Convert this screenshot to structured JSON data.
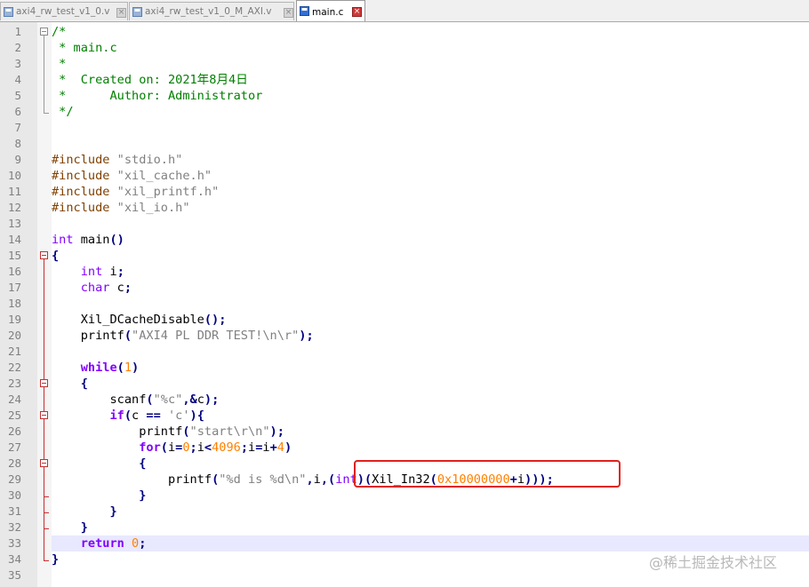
{
  "tabs": [
    {
      "label": "axi4_rw_test_v1_0.v",
      "active": false
    },
    {
      "label": "axi4_rw_test_v1_0_M_AXI.v",
      "active": false
    },
    {
      "label": "main.c",
      "active": true
    }
  ],
  "editor": {
    "current_line": 33,
    "lines": [
      [
        [
          "c-com",
          "/*"
        ]
      ],
      [
        [
          "c-com",
          " * main.c"
        ]
      ],
      [
        [
          "c-com",
          " *"
        ]
      ],
      [
        [
          "c-com",
          " *  Created on: 2021年8月4日"
        ]
      ],
      [
        [
          "c-com",
          " *      Author: Administrator"
        ]
      ],
      [
        [
          "c-com",
          " */"
        ]
      ],
      [],
      [],
      [
        [
          "c-pre",
          "#include "
        ],
        [
          "c-str",
          "\"stdio.h\""
        ]
      ],
      [
        [
          "c-pre",
          "#include "
        ],
        [
          "c-str",
          "\"xil_cache.h\""
        ]
      ],
      [
        [
          "c-pre",
          "#include "
        ],
        [
          "c-str",
          "\"xil_printf.h\""
        ]
      ],
      [
        [
          "c-pre",
          "#include "
        ],
        [
          "c-str",
          "\"xil_io.h\""
        ]
      ],
      [],
      [
        [
          "c-kw",
          "int"
        ],
        [
          "",
          " main"
        ],
        [
          "c-op",
          "()"
        ]
      ],
      [
        [
          "c-op",
          "{"
        ]
      ],
      [
        [
          "",
          "    "
        ],
        [
          "c-kw",
          "int"
        ],
        [
          "",
          " i"
        ],
        [
          "c-op",
          ";"
        ]
      ],
      [
        [
          "",
          "    "
        ],
        [
          "c-kw",
          "char"
        ],
        [
          "",
          " c"
        ],
        [
          "c-op",
          ";"
        ]
      ],
      [],
      [
        [
          "",
          "    Xil_DCacheDisable"
        ],
        [
          "c-op",
          "();"
        ]
      ],
      [
        [
          "",
          "    printf"
        ],
        [
          "c-op",
          "("
        ],
        [
          "c-str",
          "\"AXI4 PL DDR TEST!\\n\\r\""
        ],
        [
          "c-op",
          ");"
        ]
      ],
      [],
      [
        [
          "",
          "    "
        ],
        [
          "c-kw c-bold",
          "while"
        ],
        [
          "c-op",
          "("
        ],
        [
          "c-num",
          "1"
        ],
        [
          "c-op",
          ")"
        ]
      ],
      [
        [
          "",
          "    "
        ],
        [
          "c-op",
          "{"
        ]
      ],
      [
        [
          "",
          "        scanf"
        ],
        [
          "c-op",
          "("
        ],
        [
          "c-str",
          "\"%c\""
        ],
        [
          "c-op",
          ",&"
        ],
        [
          "",
          "c"
        ],
        [
          "c-op",
          ");"
        ]
      ],
      [
        [
          "",
          "        "
        ],
        [
          "c-kw c-bold",
          "if"
        ],
        [
          "c-op",
          "("
        ],
        [
          "",
          "c "
        ],
        [
          "c-op",
          "=="
        ],
        [
          "",
          " "
        ],
        [
          "c-str",
          "'c'"
        ],
        [
          "c-op",
          "){"
        ]
      ],
      [
        [
          "",
          "            printf"
        ],
        [
          "c-op",
          "("
        ],
        [
          "c-str",
          "\"start\\r\\n\""
        ],
        [
          "c-op",
          ");"
        ]
      ],
      [
        [
          "",
          "            "
        ],
        [
          "c-kw c-bold",
          "for"
        ],
        [
          "c-op",
          "("
        ],
        [
          "",
          "i"
        ],
        [
          "c-op",
          "="
        ],
        [
          "c-num",
          "0"
        ],
        [
          "c-op",
          ";"
        ],
        [
          "",
          "i"
        ],
        [
          "c-op",
          "<"
        ],
        [
          "c-num",
          "4096"
        ],
        [
          "c-op",
          ";"
        ],
        [
          "",
          "i"
        ],
        [
          "c-op",
          "="
        ],
        [
          "",
          "i"
        ],
        [
          "c-op",
          "+"
        ],
        [
          "c-num",
          "4"
        ],
        [
          "c-op",
          ")"
        ]
      ],
      [
        [
          "",
          "            "
        ],
        [
          "c-op",
          "{"
        ]
      ],
      [
        [
          "",
          "                printf"
        ],
        [
          "c-op",
          "("
        ],
        [
          "c-str",
          "\"%d is %d\\n\""
        ],
        [
          "c-op",
          ","
        ],
        [
          "",
          "i"
        ],
        [
          "c-op",
          ",("
        ],
        [
          "c-kw",
          "int"
        ],
        [
          "c-op",
          ")("
        ],
        [
          "",
          "Xil_In32"
        ],
        [
          "c-op",
          "("
        ],
        [
          "c-num",
          "0x10000000"
        ],
        [
          "c-op",
          "+"
        ],
        [
          "",
          "i"
        ],
        [
          "c-op",
          ")));"
        ]
      ],
      [
        [
          "",
          "            "
        ],
        [
          "c-op",
          "}"
        ]
      ],
      [
        [
          "",
          "        "
        ],
        [
          "c-op",
          "}"
        ]
      ],
      [
        [
          "",
          "    "
        ],
        [
          "c-op",
          "}"
        ]
      ],
      [
        [
          "",
          "    "
        ],
        [
          "c-kw c-bold",
          "return"
        ],
        [
          "",
          " "
        ],
        [
          "c-num",
          "0"
        ],
        [
          "c-op",
          ";"
        ]
      ],
      [
        [
          "c-op",
          "}"
        ]
      ],
      []
    ]
  },
  "watermark": "@稀土掘金技术社区",
  "colors": {
    "comment": "#008000",
    "preprocessor": "#804000",
    "string": "#808080",
    "keyword": "#8000ff",
    "number": "#ff8000",
    "operator": "#000080",
    "highlight_box": "#e0201c",
    "current_line": "#e8e8ff"
  }
}
